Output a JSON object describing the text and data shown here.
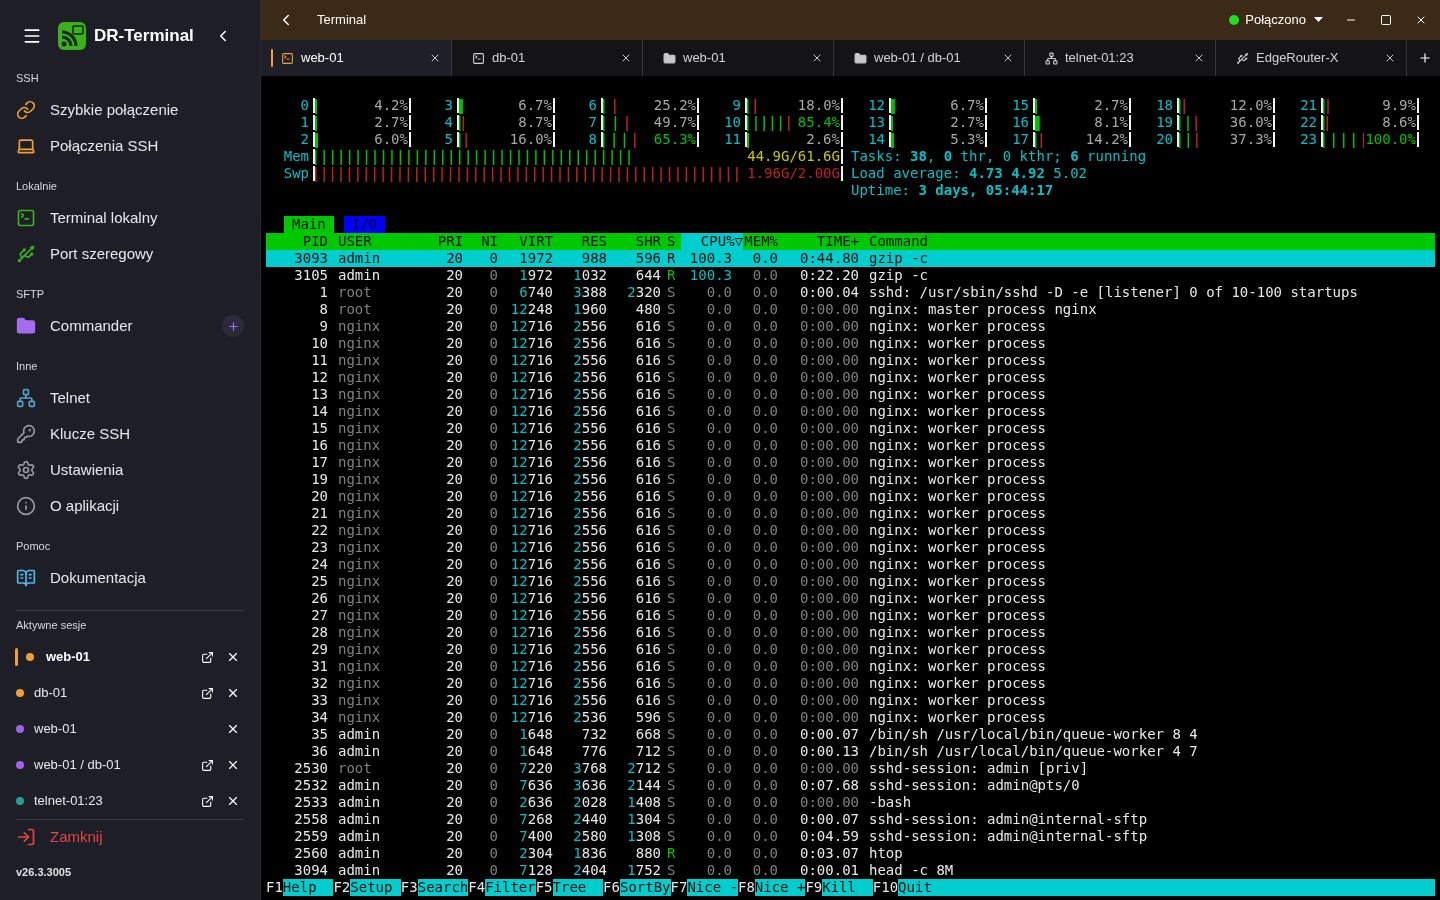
{
  "sidebar": {
    "title": "DR-Terminal",
    "sections": [
      {
        "title": "SSH",
        "items": [
          {
            "label": "Szybkie połączenie",
            "kind": "quick"
          },
          {
            "label": "Połączenia SSH",
            "kind": "ssh"
          }
        ]
      },
      {
        "title": "Lokalnie",
        "items": [
          {
            "label": "Terminal lokalny",
            "kind": "local"
          },
          {
            "label": "Port szeregowy",
            "kind": "serial"
          }
        ]
      },
      {
        "title": "SFTP",
        "items": [
          {
            "label": "Commander",
            "kind": "commander",
            "add_button": true
          }
        ]
      },
      {
        "title": "Inne",
        "items": [
          {
            "label": "Telnet",
            "kind": "telnet"
          },
          {
            "label": "Klucze SSH",
            "kind": "keys"
          },
          {
            "label": "Ustawienia",
            "kind": "settings"
          },
          {
            "label": "O aplikacji",
            "kind": "about"
          }
        ]
      },
      {
        "title": "Pomoc",
        "items": [
          {
            "label": "Dokumentacja",
            "kind": "docs"
          }
        ]
      }
    ],
    "sessions_title": "Aktywne sesje",
    "sessions": [
      {
        "label": "web-01",
        "color": "#f0a030",
        "selected": true,
        "popout": true
      },
      {
        "label": "db-01",
        "color": "#f0a030",
        "selected": false,
        "popout": true
      },
      {
        "label": "web-01",
        "color": "#a060f0",
        "selected": false,
        "popout": false
      },
      {
        "label": "web-01 / db-01",
        "color": "#a060f0",
        "selected": false,
        "popout": true
      },
      {
        "label": "telnet-01:23",
        "color": "#20a090",
        "selected": false,
        "popout": true
      }
    ],
    "close_label": "Zamknij",
    "version": "v26.3.3005"
  },
  "topbar": {
    "title": "Terminal",
    "status": "Połączono"
  },
  "tabs": [
    {
      "label": "web-01",
      "kind": "ssh",
      "selected": true
    },
    {
      "label": "db-01",
      "kind": "ssh",
      "selected": false
    },
    {
      "label": "web-01",
      "kind": "sftp",
      "selected": false
    },
    {
      "label": "web-01 / db-01",
      "kind": "sftp",
      "selected": false
    },
    {
      "label": "telnet-01:23",
      "kind": "telnet",
      "selected": false
    },
    {
      "label": "EdgeRouter-X",
      "kind": "serial",
      "selected": false
    }
  ],
  "terminal": {
    "cpus": [
      {
        "label": "0",
        "level": 0.042,
        "reading": "4.2%"
      },
      {
        "label": "3",
        "level": 0.067,
        "reading": "6.7%"
      },
      {
        "label": "6",
        "level": 0.252,
        "reading": "25.2%"
      },
      {
        "label": "9",
        "level": 0.18,
        "reading": "18.0%"
      },
      {
        "label": "12",
        "level": 0.067,
        "reading": "6.7%"
      },
      {
        "label": "15",
        "level": 0.027,
        "reading": "2.7%"
      },
      {
        "label": "18",
        "level": 0.12,
        "reading": "12.0%"
      },
      {
        "label": "21",
        "level": 0.099,
        "reading": "9.9%"
      },
      {
        "label": "1",
        "level": 0.027,
        "reading": "2.7%"
      },
      {
        "label": "4",
        "level": 0.087,
        "reading": "8.7%"
      },
      {
        "label": "7",
        "level": 0.497,
        "reading": "49.7%"
      },
      {
        "label": "10",
        "level": 0.854,
        "reading": "85.4%"
      },
      {
        "label": "13",
        "level": 0.027,
        "reading": "2.7%"
      },
      {
        "label": "16",
        "level": 0.081,
        "reading": "8.1%"
      },
      {
        "label": "19",
        "level": 0.36,
        "reading": "36.0%"
      },
      {
        "label": "22",
        "level": 0.086,
        "reading": "8.6%"
      },
      {
        "label": "2",
        "level": 0.06,
        "reading": "6.0%"
      },
      {
        "label": "5",
        "level": 0.16,
        "reading": "16.0%"
      },
      {
        "label": "8",
        "level": 0.653,
        "reading": "65.3%"
      },
      {
        "label": "11",
        "level": 0.026,
        "reading": "2.6%"
      },
      {
        "label": "14",
        "level": 0.053,
        "reading": "5.3%"
      },
      {
        "label": "17",
        "level": 0.142,
        "reading": "14.2%"
      },
      {
        "label": "20",
        "level": 0.373,
        "reading": "37.3%"
      },
      {
        "label": "23",
        "level": 1.0,
        "reading": "100.0%"
      }
    ],
    "memory": [
      {
        "label": "Mem",
        "kind": "mem",
        "level": 0.73,
        "reading": "44.9G/61.6G"
      },
      {
        "label": "Swp",
        "kind": "swap",
        "level": 0.98,
        "reading": "1.96G/2.00G"
      }
    ],
    "summary": [
      "Tasks: **38**, **0** thr, 0 kthr; **6** running",
      "Load average: **4.73** **4.92** 5.02",
      "Uptime: **3 days, 05:44:17**"
    ],
    "views": [
      {
        "label": "Main",
        "selected": true
      },
      {
        "label": "I/O",
        "selected": false
      }
    ],
    "sort_mark": "▽",
    "columns": [
      {
        "label": "PID",
        "sorted": false
      },
      {
        "label": "USER",
        "sorted": false
      },
      {
        "label": "PRI",
        "sorted": false
      },
      {
        "label": "NI",
        "sorted": false
      },
      {
        "label": "VIRT",
        "sorted": false
      },
      {
        "label": "RES",
        "sorted": false
      },
      {
        "label": "SHR",
        "sorted": false
      },
      {
        "label": "S",
        "sorted": false
      },
      {
        "label": "CPU%",
        "sorted": true
      },
      {
        "label": "MEM%",
        "sorted": false
      },
      {
        "label": "TIME+",
        "sorted": false
      },
      {
        "label": "Command",
        "sorted": false
      }
    ],
    "processes": [
      {
        "cells": [
          "3093",
          "admin",
          "20",
          "0",
          "1972",
          "988",
          "596",
          "R",
          "100.3",
          "0.0",
          "0:44.80",
          "gzip -c"
        ],
        "selected": true,
        "running": true,
        "busy": true,
        "other_user": false,
        "idle_time": false
      },
      {
        "cells": [
          "3105",
          "admin",
          "20",
          "0",
          "1972",
          "1032",
          "644",
          "R",
          "100.3",
          "0.0",
          "0:22.20",
          "gzip -c"
        ],
        "selected": false,
        "running": true,
        "busy": true,
        "other_user": false,
        "idle_time": false
      },
      {
        "cells": [
          "1",
          "root",
          "20",
          "0",
          "6740",
          "3388",
          "2320",
          "S",
          "0.0",
          "0.0",
          "0:00.04",
          "sshd: /usr/sbin/sshd -D -e [listener] 0 of 10-100 startups"
        ],
        "selected": false,
        "running": false,
        "busy": false,
        "other_user": true,
        "idle_time": false
      },
      {
        "cells": [
          "8",
          "root",
          "20",
          "0",
          "12248",
          "1960",
          "480",
          "S",
          "0.0",
          "0.0",
          "0:00.00",
          "nginx: master process nginx"
        ],
        "selected": false,
        "running": false,
        "busy": false,
        "other_user": true,
        "idle_time": true
      },
      {
        "cells": [
          "9",
          "nginx",
          "20",
          "0",
          "12716",
          "2556",
          "616",
          "S",
          "0.0",
          "0.0",
          "0:00.00",
          "nginx: worker process"
        ],
        "selected": false,
        "running": false,
        "busy": false,
        "other_user": true,
        "idle_time": true
      },
      {
        "cells": [
          "10",
          "nginx",
          "20",
          "0",
          "12716",
          "2556",
          "616",
          "S",
          "0.0",
          "0.0",
          "0:00.00",
          "nginx: worker process"
        ],
        "selected": false,
        "running": false,
        "busy": false,
        "other_user": true,
        "idle_time": true
      },
      {
        "cells": [
          "11",
          "nginx",
          "20",
          "0",
          "12716",
          "2556",
          "616",
          "S",
          "0.0",
          "0.0",
          "0:00.00",
          "nginx: worker process"
        ],
        "selected": false,
        "running": false,
        "busy": false,
        "other_user": true,
        "idle_time": true
      },
      {
        "cells": [
          "12",
          "nginx",
          "20",
          "0",
          "12716",
          "2556",
          "616",
          "S",
          "0.0",
          "0.0",
          "0:00.00",
          "nginx: worker process"
        ],
        "selected": false,
        "running": false,
        "busy": false,
        "other_user": true,
        "idle_time": true
      },
      {
        "cells": [
          "13",
          "nginx",
          "20",
          "0",
          "12716",
          "2556",
          "616",
          "S",
          "0.0",
          "0.0",
          "0:00.00",
          "nginx: worker process"
        ],
        "selected": false,
        "running": false,
        "busy": false,
        "other_user": true,
        "idle_time": true
      },
      {
        "cells": [
          "14",
          "nginx",
          "20",
          "0",
          "12716",
          "2556",
          "616",
          "S",
          "0.0",
          "0.0",
          "0:00.00",
          "nginx: worker process"
        ],
        "selected": false,
        "running": false,
        "busy": false,
        "other_user": true,
        "idle_time": true
      },
      {
        "cells": [
          "15",
          "nginx",
          "20",
          "0",
          "12716",
          "2556",
          "616",
          "S",
          "0.0",
          "0.0",
          "0:00.00",
          "nginx: worker process"
        ],
        "selected": false,
        "running": false,
        "busy": false,
        "other_user": true,
        "idle_time": true
      },
      {
        "cells": [
          "16",
          "nginx",
          "20",
          "0",
          "12716",
          "2556",
          "616",
          "S",
          "0.0",
          "0.0",
          "0:00.00",
          "nginx: worker process"
        ],
        "selected": false,
        "running": false,
        "busy": false,
        "other_user": true,
        "idle_time": true
      },
      {
        "cells": [
          "17",
          "nginx",
          "20",
          "0",
          "12716",
          "2556",
          "616",
          "S",
          "0.0",
          "0.0",
          "0:00.00",
          "nginx: worker process"
        ],
        "selected": false,
        "running": false,
        "busy": false,
        "other_user": true,
        "idle_time": true
      },
      {
        "cells": [
          "19",
          "nginx",
          "20",
          "0",
          "12716",
          "2556",
          "616",
          "S",
          "0.0",
          "0.0",
          "0:00.00",
          "nginx: worker process"
        ],
        "selected": false,
        "running": false,
        "busy": false,
        "other_user": true,
        "idle_time": true
      },
      {
        "cells": [
          "20",
          "nginx",
          "20",
          "0",
          "12716",
          "2556",
          "616",
          "S",
          "0.0",
          "0.0",
          "0:00.00",
          "nginx: worker process"
        ],
        "selected": false,
        "running": false,
        "busy": false,
        "other_user": true,
        "idle_time": true
      },
      {
        "cells": [
          "21",
          "nginx",
          "20",
          "0",
          "12716",
          "2556",
          "616",
          "S",
          "0.0",
          "0.0",
          "0:00.00",
          "nginx: worker process"
        ],
        "selected": false,
        "running": false,
        "busy": false,
        "other_user": true,
        "idle_time": true
      },
      {
        "cells": [
          "22",
          "nginx",
          "20",
          "0",
          "12716",
          "2556",
          "616",
          "S",
          "0.0",
          "0.0",
          "0:00.00",
          "nginx: worker process"
        ],
        "selected": false,
        "running": false,
        "busy": false,
        "other_user": true,
        "idle_time": true
      },
      {
        "cells": [
          "23",
          "nginx",
          "20",
          "0",
          "12716",
          "2556",
          "616",
          "S",
          "0.0",
          "0.0",
          "0:00.00",
          "nginx: worker process"
        ],
        "selected": false,
        "running": false,
        "busy": false,
        "other_user": true,
        "idle_time": true
      },
      {
        "cells": [
          "24",
          "nginx",
          "20",
          "0",
          "12716",
          "2556",
          "616",
          "S",
          "0.0",
          "0.0",
          "0:00.00",
          "nginx: worker process"
        ],
        "selected": false,
        "running": false,
        "busy": false,
        "other_user": true,
        "idle_time": true
      },
      {
        "cells": [
          "25",
          "nginx",
          "20",
          "0",
          "12716",
          "2556",
          "616",
          "S",
          "0.0",
          "0.0",
          "0:00.00",
          "nginx: worker process"
        ],
        "selected": false,
        "running": false,
        "busy": false,
        "other_user": true,
        "idle_time": true
      },
      {
        "cells": [
          "26",
          "nginx",
          "20",
          "0",
          "12716",
          "2556",
          "616",
          "S",
          "0.0",
          "0.0",
          "0:00.00",
          "nginx: worker process"
        ],
        "selected": false,
        "running": false,
        "busy": false,
        "other_user": true,
        "idle_time": true
      },
      {
        "cells": [
          "27",
          "nginx",
          "20",
          "0",
          "12716",
          "2556",
          "616",
          "S",
          "0.0",
          "0.0",
          "0:00.00",
          "nginx: worker process"
        ],
        "selected": false,
        "running": false,
        "busy": false,
        "other_user": true,
        "idle_time": true
      },
      {
        "cells": [
          "28",
          "nginx",
          "20",
          "0",
          "12716",
          "2556",
          "616",
          "S",
          "0.0",
          "0.0",
          "0:00.00",
          "nginx: worker process"
        ],
        "selected": false,
        "running": false,
        "busy": false,
        "other_user": true,
        "idle_time": true
      },
      {
        "cells": [
          "29",
          "nginx",
          "20",
          "0",
          "12716",
          "2556",
          "616",
          "S",
          "0.0",
          "0.0",
          "0:00.00",
          "nginx: worker process"
        ],
        "selected": false,
        "running": false,
        "busy": false,
        "other_user": true,
        "idle_time": true
      },
      {
        "cells": [
          "31",
          "nginx",
          "20",
          "0",
          "12716",
          "2556",
          "616",
          "S",
          "0.0",
          "0.0",
          "0:00.00",
          "nginx: worker process"
        ],
        "selected": false,
        "running": false,
        "busy": false,
        "other_user": true,
        "idle_time": true
      },
      {
        "cells": [
          "32",
          "nginx",
          "20",
          "0",
          "12716",
          "2556",
          "616",
          "S",
          "0.0",
          "0.0",
          "0:00.00",
          "nginx: worker process"
        ],
        "selected": false,
        "running": false,
        "busy": false,
        "other_user": true,
        "idle_time": true
      },
      {
        "cells": [
          "33",
          "nginx",
          "20",
          "0",
          "12716",
          "2556",
          "616",
          "S",
          "0.0",
          "0.0",
          "0:00.00",
          "nginx: worker process"
        ],
        "selected": false,
        "running": false,
        "busy": false,
        "other_user": true,
        "idle_time": true
      },
      {
        "cells": [
          "34",
          "nginx",
          "20",
          "0",
          "12716",
          "2536",
          "596",
          "S",
          "0.0",
          "0.0",
          "0:00.00",
          "nginx: worker process"
        ],
        "selected": false,
        "running": false,
        "busy": false,
        "other_user": true,
        "idle_time": true
      },
      {
        "cells": [
          "35",
          "admin",
          "20",
          "0",
          "1648",
          "732",
          "668",
          "S",
          "0.0",
          "0.0",
          "0:00.07",
          "/bin/sh /usr/local/bin/queue-worker 8 4"
        ],
        "selected": false,
        "running": false,
        "busy": false,
        "other_user": false,
        "idle_time": false
      },
      {
        "cells": [
          "36",
          "admin",
          "20",
          "0",
          "1648",
          "776",
          "712",
          "S",
          "0.0",
          "0.0",
          "0:00.13",
          "/bin/sh /usr/local/bin/queue-worker 4 7"
        ],
        "selected": false,
        "running": false,
        "busy": false,
        "other_user": false,
        "idle_time": false
      },
      {
        "cells": [
          "2530",
          "root",
          "20",
          "0",
          "7220",
          "3768",
          "2712",
          "S",
          "0.0",
          "0.0",
          "0:00.00",
          "sshd-session: admin [priv]"
        ],
        "selected": false,
        "running": false,
        "busy": false,
        "other_user": true,
        "idle_time": true
      },
      {
        "cells": [
          "2532",
          "admin",
          "20",
          "0",
          "7636",
          "3636",
          "2144",
          "S",
          "0.0",
          "0.0",
          "0:07.68",
          "sshd-session: admin@pts/0"
        ],
        "selected": false,
        "running": false,
        "busy": false,
        "other_user": false,
        "idle_time": false
      },
      {
        "cells": [
          "2533",
          "admin",
          "20",
          "0",
          "2636",
          "2028",
          "1408",
          "S",
          "0.0",
          "0.0",
          "0:00.00",
          "-bash"
        ],
        "selected": false,
        "running": false,
        "busy": false,
        "other_user": false,
        "idle_time": true
      },
      {
        "cells": [
          "2558",
          "admin",
          "20",
          "0",
          "7268",
          "2440",
          "1304",
          "S",
          "0.0",
          "0.0",
          "0:00.07",
          "sshd-session: admin@internal-sftp"
        ],
        "selected": false,
        "running": false,
        "busy": false,
        "other_user": false,
        "idle_time": false
      },
      {
        "cells": [
          "2559",
          "admin",
          "20",
          "0",
          "7400",
          "2580",
          "1308",
          "S",
          "0.0",
          "0.0",
          "0:04.59",
          "sshd-session: admin@internal-sftp"
        ],
        "selected": false,
        "running": false,
        "busy": false,
        "other_user": false,
        "idle_time": false
      },
      {
        "cells": [
          "2560",
          "admin",
          "20",
          "0",
          "2304",
          "1836",
          "880",
          "R",
          "0.0",
          "0.0",
          "0:03.07",
          "htop"
        ],
        "selected": false,
        "running": true,
        "busy": false,
        "other_user": false,
        "idle_time": false
      },
      {
        "cells": [
          "3094",
          "admin",
          "20",
          "0",
          "7128",
          "2404",
          "1752",
          "S",
          "0.0",
          "0.0",
          "0:00.01",
          "head -c 8M"
        ],
        "selected": false,
        "running": false,
        "busy": false,
        "other_user": false,
        "idle_time": false
      }
    ],
    "function_keys": [
      {
        "key": "F1",
        "label": "Help"
      },
      {
        "key": "F2",
        "label": "Setup"
      },
      {
        "key": "F3",
        "label": "Search"
      },
      {
        "key": "F4",
        "label": "Filter"
      },
      {
        "key": "F5",
        "label": "Tree"
      },
      {
        "key": "F6",
        "label": "SortBy"
      },
      {
        "key": "F7",
        "label": "Nice -"
      },
      {
        "key": "F8",
        "label": "Nice +"
      },
      {
        "key": "F9",
        "label": "Kill"
      },
      {
        "key": "F10",
        "label": "Quit"
      }
    ]
  }
}
